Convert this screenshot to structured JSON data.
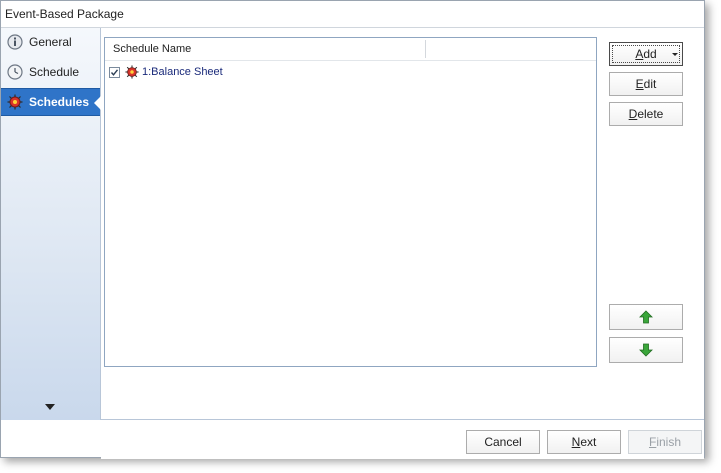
{
  "window": {
    "title": "Event-Based Package"
  },
  "sidebar": {
    "items": [
      {
        "label": "General",
        "icon": "info-icon",
        "active": false
      },
      {
        "label": "Schedule",
        "icon": "clock-icon",
        "active": false
      },
      {
        "label": "Schedules",
        "icon": "schedules-icon",
        "active": true
      }
    ]
  },
  "list": {
    "columns": [
      "Schedule Name"
    ],
    "rows": [
      {
        "checked": true,
        "icon": "event-schedule-icon",
        "label": "1:Balance Sheet"
      }
    ]
  },
  "actions": {
    "add": {
      "label": "Add",
      "mnemonic": "A",
      "rest": "dd"
    },
    "edit": {
      "label": "Edit",
      "mnemonic": "E",
      "rest": "dit"
    },
    "delete": {
      "label": "Delete",
      "mnemonic": "D",
      "rest": "elete"
    },
    "move_up": {
      "icon": "arrow-up-icon"
    },
    "move_down": {
      "icon": "arrow-down-icon"
    }
  },
  "footer": {
    "cancel": {
      "label": "Cancel"
    },
    "next": {
      "label": "Next",
      "mnemonic": "N",
      "rest": "ext"
    },
    "finish": {
      "label": "Finish",
      "mnemonic": "F",
      "rest": "inish",
      "disabled": true
    }
  },
  "colors": {
    "accent": "#2f74c8",
    "arrow_green": "#3aa63a"
  }
}
